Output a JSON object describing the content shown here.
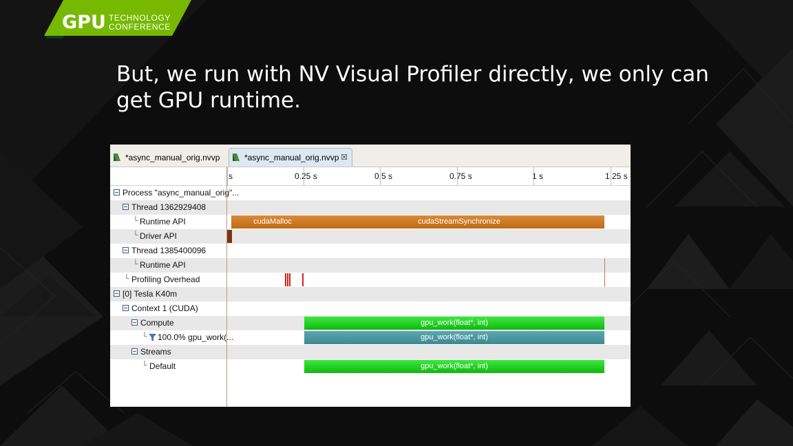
{
  "logo": {
    "main": "GPU",
    "line1": "TECHNOLOGY",
    "line2": "CONFERENCE"
  },
  "slide": {
    "title_line1": "But, we run with NV Visual Profiler directly,  we only can",
    "title_line2": "get GPU runtime."
  },
  "profiler": {
    "tabs": [
      {
        "label": "*async_manual_orig.nvvp",
        "active": false
      },
      {
        "label": "*async_manual_orig.nvvp",
        "active": true,
        "close": "☒"
      }
    ],
    "ruler_ticks": [
      "s",
      "0.25 s",
      "0.5 s",
      "0.75 s",
      "1 s",
      "1.25 s"
    ],
    "rows": [
      {
        "label": "Process \"async_manual_orig\"...",
        "kind": "toggle"
      },
      {
        "label": "Thread 1362929408",
        "kind": "toggle"
      },
      {
        "label": "Runtime API",
        "kind": "leaf"
      },
      {
        "label": "Driver API",
        "kind": "leaf"
      },
      {
        "label": "Thread 1385400096",
        "kind": "toggle"
      },
      {
        "label": "Runtime API",
        "kind": "leaf"
      },
      {
        "label": "Profiling Overhead",
        "kind": "leaf"
      },
      {
        "label": "[0] Tesla K40m",
        "kind": "toggle"
      },
      {
        "label": "Context 1 (CUDA)",
        "kind": "toggle"
      },
      {
        "label": "Compute",
        "kind": "toggle"
      },
      {
        "label": "100.0% gpu_work(...",
        "kind": "filter"
      },
      {
        "label": "Streams",
        "kind": "toggle"
      },
      {
        "label": "Default",
        "kind": "leaf"
      }
    ],
    "bars": {
      "cudaMalloc": "cudaMalloc",
      "cudaStreamSynchronize": "cudaStreamSynchronize",
      "compute_kernel": "gpu_work(float*, int)",
      "compute_kernel_pct": "gpu_work(float*, int)",
      "stream_kernel": "gpu_work(float*, int)"
    },
    "colors": {
      "runtime_api": "#c97522",
      "driver_api": "#7a3510",
      "kernel": "#22cc22",
      "kernel_filtered": "#4a99a2",
      "overhead": "#d62020"
    }
  }
}
